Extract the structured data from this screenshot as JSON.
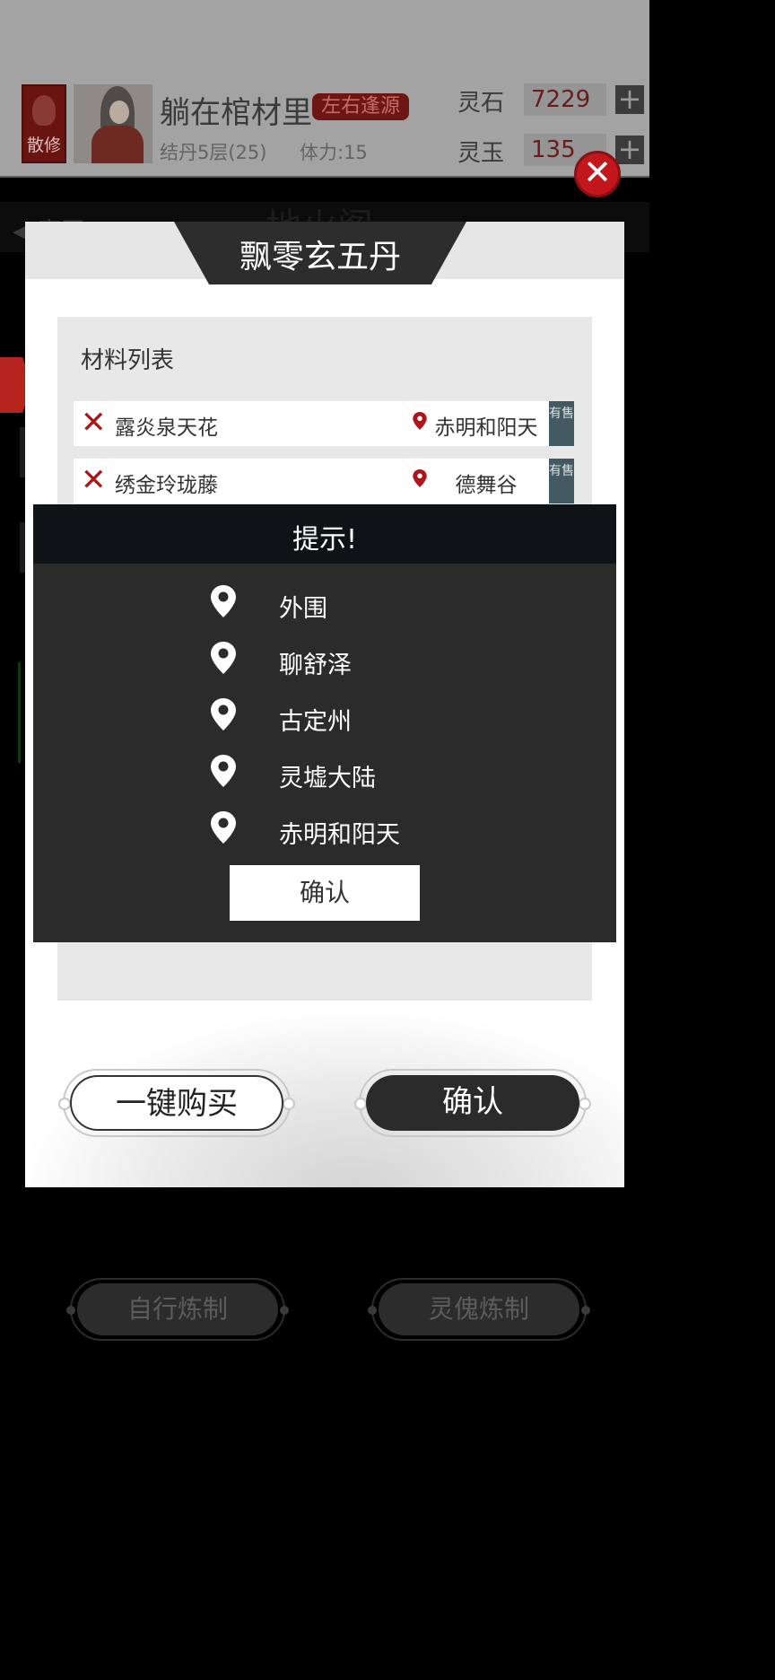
{
  "player": {
    "sect": "散修",
    "name": "躺在棺材里",
    "tag": "左右逢源",
    "level": "结丹5层(25)",
    "stamina": "体力:15"
  },
  "resources": [
    {
      "label": "灵石",
      "value": "7229",
      "plus": "+"
    },
    {
      "label": "灵玉",
      "value": "135",
      "plus": "+"
    }
  ],
  "background": {
    "back": "◀ 离开",
    "tab_title": "地火阁"
  },
  "close": "✕",
  "modal": {
    "title": "飘零玄五丹",
    "list_title": "材料列表",
    "materials": [
      {
        "mark": "✕",
        "name": "露炎泉天花",
        "location": "赤明和阳天",
        "sale": "有售"
      },
      {
        "mark": "✕",
        "name": "绣金玲珑藤",
        "location": "德舞谷",
        "sale": "有售"
      }
    ],
    "buy_all": "一键购买",
    "confirm": "确认"
  },
  "tip": {
    "title": "提示!",
    "locations": [
      "外围",
      "聊舒泽",
      "古定州",
      "灵墟大陆",
      "赤明和阳天"
    ],
    "ok": "确认"
  },
  "bottom": {
    "self_refine": "自行炼制",
    "puppet_refine": "灵傀炼制"
  },
  "colors": {
    "accent_red": "#b01419",
    "close_red": "#c2181d",
    "dark": "#2b2b2b"
  }
}
